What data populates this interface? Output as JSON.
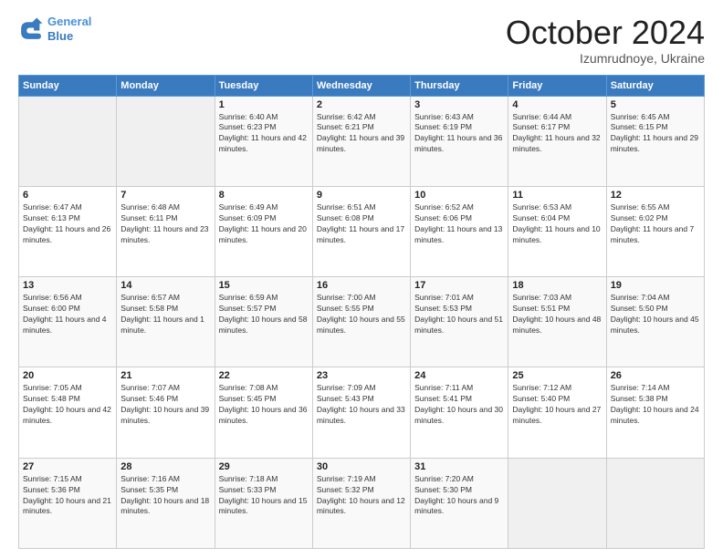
{
  "header": {
    "logo_line1": "General",
    "logo_line2": "Blue",
    "month_title": "October 2024",
    "location": "Izumrudnoye, Ukraine"
  },
  "days_of_week": [
    "Sunday",
    "Monday",
    "Tuesday",
    "Wednesday",
    "Thursday",
    "Friday",
    "Saturday"
  ],
  "weeks": [
    [
      {
        "num": "",
        "info": ""
      },
      {
        "num": "",
        "info": ""
      },
      {
        "num": "1",
        "info": "Sunrise: 6:40 AM\nSunset: 6:23 PM\nDaylight: 11 hours and 42 minutes."
      },
      {
        "num": "2",
        "info": "Sunrise: 6:42 AM\nSunset: 6:21 PM\nDaylight: 11 hours and 39 minutes."
      },
      {
        "num": "3",
        "info": "Sunrise: 6:43 AM\nSunset: 6:19 PM\nDaylight: 11 hours and 36 minutes."
      },
      {
        "num": "4",
        "info": "Sunrise: 6:44 AM\nSunset: 6:17 PM\nDaylight: 11 hours and 32 minutes."
      },
      {
        "num": "5",
        "info": "Sunrise: 6:45 AM\nSunset: 6:15 PM\nDaylight: 11 hours and 29 minutes."
      }
    ],
    [
      {
        "num": "6",
        "info": "Sunrise: 6:47 AM\nSunset: 6:13 PM\nDaylight: 11 hours and 26 minutes."
      },
      {
        "num": "7",
        "info": "Sunrise: 6:48 AM\nSunset: 6:11 PM\nDaylight: 11 hours and 23 minutes."
      },
      {
        "num": "8",
        "info": "Sunrise: 6:49 AM\nSunset: 6:09 PM\nDaylight: 11 hours and 20 minutes."
      },
      {
        "num": "9",
        "info": "Sunrise: 6:51 AM\nSunset: 6:08 PM\nDaylight: 11 hours and 17 minutes."
      },
      {
        "num": "10",
        "info": "Sunrise: 6:52 AM\nSunset: 6:06 PM\nDaylight: 11 hours and 13 minutes."
      },
      {
        "num": "11",
        "info": "Sunrise: 6:53 AM\nSunset: 6:04 PM\nDaylight: 11 hours and 10 minutes."
      },
      {
        "num": "12",
        "info": "Sunrise: 6:55 AM\nSunset: 6:02 PM\nDaylight: 11 hours and 7 minutes."
      }
    ],
    [
      {
        "num": "13",
        "info": "Sunrise: 6:56 AM\nSunset: 6:00 PM\nDaylight: 11 hours and 4 minutes."
      },
      {
        "num": "14",
        "info": "Sunrise: 6:57 AM\nSunset: 5:58 PM\nDaylight: 11 hours and 1 minute."
      },
      {
        "num": "15",
        "info": "Sunrise: 6:59 AM\nSunset: 5:57 PM\nDaylight: 10 hours and 58 minutes."
      },
      {
        "num": "16",
        "info": "Sunrise: 7:00 AM\nSunset: 5:55 PM\nDaylight: 10 hours and 55 minutes."
      },
      {
        "num": "17",
        "info": "Sunrise: 7:01 AM\nSunset: 5:53 PM\nDaylight: 10 hours and 51 minutes."
      },
      {
        "num": "18",
        "info": "Sunrise: 7:03 AM\nSunset: 5:51 PM\nDaylight: 10 hours and 48 minutes."
      },
      {
        "num": "19",
        "info": "Sunrise: 7:04 AM\nSunset: 5:50 PM\nDaylight: 10 hours and 45 minutes."
      }
    ],
    [
      {
        "num": "20",
        "info": "Sunrise: 7:05 AM\nSunset: 5:48 PM\nDaylight: 10 hours and 42 minutes."
      },
      {
        "num": "21",
        "info": "Sunrise: 7:07 AM\nSunset: 5:46 PM\nDaylight: 10 hours and 39 minutes."
      },
      {
        "num": "22",
        "info": "Sunrise: 7:08 AM\nSunset: 5:45 PM\nDaylight: 10 hours and 36 minutes."
      },
      {
        "num": "23",
        "info": "Sunrise: 7:09 AM\nSunset: 5:43 PM\nDaylight: 10 hours and 33 minutes."
      },
      {
        "num": "24",
        "info": "Sunrise: 7:11 AM\nSunset: 5:41 PM\nDaylight: 10 hours and 30 minutes."
      },
      {
        "num": "25",
        "info": "Sunrise: 7:12 AM\nSunset: 5:40 PM\nDaylight: 10 hours and 27 minutes."
      },
      {
        "num": "26",
        "info": "Sunrise: 7:14 AM\nSunset: 5:38 PM\nDaylight: 10 hours and 24 minutes."
      }
    ],
    [
      {
        "num": "27",
        "info": "Sunrise: 7:15 AM\nSunset: 5:36 PM\nDaylight: 10 hours and 21 minutes."
      },
      {
        "num": "28",
        "info": "Sunrise: 7:16 AM\nSunset: 5:35 PM\nDaylight: 10 hours and 18 minutes."
      },
      {
        "num": "29",
        "info": "Sunrise: 7:18 AM\nSunset: 5:33 PM\nDaylight: 10 hours and 15 minutes."
      },
      {
        "num": "30",
        "info": "Sunrise: 7:19 AM\nSunset: 5:32 PM\nDaylight: 10 hours and 12 minutes."
      },
      {
        "num": "31",
        "info": "Sunrise: 7:20 AM\nSunset: 5:30 PM\nDaylight: 10 hours and 9 minutes."
      },
      {
        "num": "",
        "info": ""
      },
      {
        "num": "",
        "info": ""
      }
    ]
  ]
}
